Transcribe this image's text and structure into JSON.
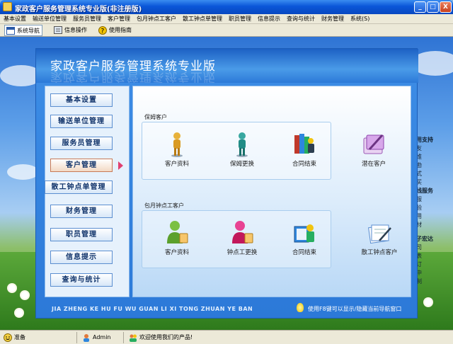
{
  "window": {
    "title": "家政客户服务管理系统专业版(非注册版)",
    "buttons": {
      "minimize": "_",
      "maximize": "□",
      "close": "X"
    }
  },
  "menubar": [
    "基本设置",
    "输送单位管理",
    "服务员管理",
    "客户管理",
    "包月钟点工客户",
    "散工钟点单管理",
    "职员管理",
    "信息提示",
    "查询与统计",
    "财务管理",
    "系统(S)"
  ],
  "toolbar": [
    {
      "label": "系统导航",
      "icon": "navigation-icon",
      "active": true
    },
    {
      "label": "信息操作",
      "icon": "info-icon",
      "active": false
    },
    {
      "label": "使用指南",
      "icon": "help-icon",
      "active": false
    }
  ],
  "desktop_side_text": [
    "用支持",
    "友",
    "维",
    "勘",
    "式",
    "买",
    "线服务",
    "服",
    "验",
    "用",
    "材",
    "子宏达",
    "司",
    "表",
    "订",
    "中",
    "制"
  ],
  "main": {
    "header_title": "家政客户服务管理系统专业版",
    "nav": [
      "基本设置",
      "输送单位管理",
      "服务员管理",
      "客户管理",
      "散工钟点单管理",
      "财务管理",
      "职员管理",
      "信息提示",
      "查询与统计"
    ],
    "active_nav": "客户管理",
    "section1": {
      "title": "保姆客户",
      "items": [
        {
          "label": "客户资料",
          "icon": "person-gold-icon"
        },
        {
          "label": "保姆更换",
          "icon": "person-teal-icon"
        },
        {
          "label": "合同结束",
          "icon": "books-people-icon"
        }
      ],
      "extra": {
        "label": "潜在客户",
        "icon": "notepad-pen-icon"
      }
    },
    "section2": {
      "title": "包月钟点工客户",
      "items": [
        {
          "label": "客户资料",
          "icon": "person-green-bag-icon"
        },
        {
          "label": "钟点工更换",
          "icon": "person-pink-bag-icon"
        },
        {
          "label": "合同结束",
          "icon": "book-person-icon"
        }
      ],
      "extra": {
        "label": "散工钟点客户",
        "icon": "papers-pen-icon"
      }
    },
    "footer_pinyin": "JIA ZHENG KE HU FU WU GUAN LI XI TONG ZHUAN YE BAN",
    "hint": "使用F8键可以显示/隐藏当前导航窗口"
  },
  "status": {
    "ready": "准备",
    "user": "Admin",
    "welcome": "欢迎使用我们的产品!"
  },
  "colors": {
    "titlebar": "#0a56d8",
    "accent": "#2c79d8",
    "active_arrow": "#e04070"
  }
}
